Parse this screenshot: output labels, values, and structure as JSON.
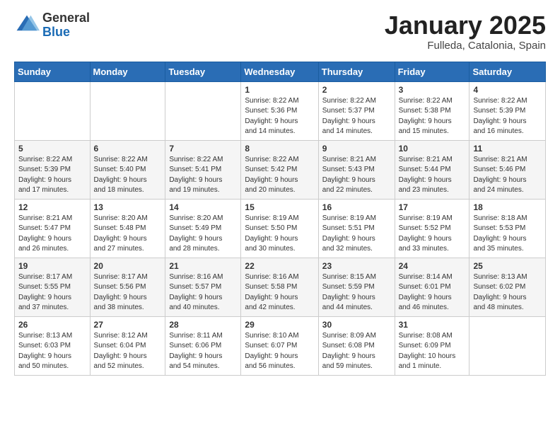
{
  "header": {
    "logo_general": "General",
    "logo_blue": "Blue",
    "month_title": "January 2025",
    "location": "Fulleda, Catalonia, Spain"
  },
  "days_of_week": [
    "Sunday",
    "Monday",
    "Tuesday",
    "Wednesday",
    "Thursday",
    "Friday",
    "Saturday"
  ],
  "weeks": [
    [
      {
        "day": "",
        "info": ""
      },
      {
        "day": "",
        "info": ""
      },
      {
        "day": "",
        "info": ""
      },
      {
        "day": "1",
        "info": "Sunrise: 8:22 AM\nSunset: 5:36 PM\nDaylight: 9 hours\nand 14 minutes."
      },
      {
        "day": "2",
        "info": "Sunrise: 8:22 AM\nSunset: 5:37 PM\nDaylight: 9 hours\nand 14 minutes."
      },
      {
        "day": "3",
        "info": "Sunrise: 8:22 AM\nSunset: 5:38 PM\nDaylight: 9 hours\nand 15 minutes."
      },
      {
        "day": "4",
        "info": "Sunrise: 8:22 AM\nSunset: 5:39 PM\nDaylight: 9 hours\nand 16 minutes."
      }
    ],
    [
      {
        "day": "5",
        "info": "Sunrise: 8:22 AM\nSunset: 5:39 PM\nDaylight: 9 hours\nand 17 minutes."
      },
      {
        "day": "6",
        "info": "Sunrise: 8:22 AM\nSunset: 5:40 PM\nDaylight: 9 hours\nand 18 minutes."
      },
      {
        "day": "7",
        "info": "Sunrise: 8:22 AM\nSunset: 5:41 PM\nDaylight: 9 hours\nand 19 minutes."
      },
      {
        "day": "8",
        "info": "Sunrise: 8:22 AM\nSunset: 5:42 PM\nDaylight: 9 hours\nand 20 minutes."
      },
      {
        "day": "9",
        "info": "Sunrise: 8:21 AM\nSunset: 5:43 PM\nDaylight: 9 hours\nand 22 minutes."
      },
      {
        "day": "10",
        "info": "Sunrise: 8:21 AM\nSunset: 5:44 PM\nDaylight: 9 hours\nand 23 minutes."
      },
      {
        "day": "11",
        "info": "Sunrise: 8:21 AM\nSunset: 5:46 PM\nDaylight: 9 hours\nand 24 minutes."
      }
    ],
    [
      {
        "day": "12",
        "info": "Sunrise: 8:21 AM\nSunset: 5:47 PM\nDaylight: 9 hours\nand 26 minutes."
      },
      {
        "day": "13",
        "info": "Sunrise: 8:20 AM\nSunset: 5:48 PM\nDaylight: 9 hours\nand 27 minutes."
      },
      {
        "day": "14",
        "info": "Sunrise: 8:20 AM\nSunset: 5:49 PM\nDaylight: 9 hours\nand 28 minutes."
      },
      {
        "day": "15",
        "info": "Sunrise: 8:19 AM\nSunset: 5:50 PM\nDaylight: 9 hours\nand 30 minutes."
      },
      {
        "day": "16",
        "info": "Sunrise: 8:19 AM\nSunset: 5:51 PM\nDaylight: 9 hours\nand 32 minutes."
      },
      {
        "day": "17",
        "info": "Sunrise: 8:19 AM\nSunset: 5:52 PM\nDaylight: 9 hours\nand 33 minutes."
      },
      {
        "day": "18",
        "info": "Sunrise: 8:18 AM\nSunset: 5:53 PM\nDaylight: 9 hours\nand 35 minutes."
      }
    ],
    [
      {
        "day": "19",
        "info": "Sunrise: 8:17 AM\nSunset: 5:55 PM\nDaylight: 9 hours\nand 37 minutes."
      },
      {
        "day": "20",
        "info": "Sunrise: 8:17 AM\nSunset: 5:56 PM\nDaylight: 9 hours\nand 38 minutes."
      },
      {
        "day": "21",
        "info": "Sunrise: 8:16 AM\nSunset: 5:57 PM\nDaylight: 9 hours\nand 40 minutes."
      },
      {
        "day": "22",
        "info": "Sunrise: 8:16 AM\nSunset: 5:58 PM\nDaylight: 9 hours\nand 42 minutes."
      },
      {
        "day": "23",
        "info": "Sunrise: 8:15 AM\nSunset: 5:59 PM\nDaylight: 9 hours\nand 44 minutes."
      },
      {
        "day": "24",
        "info": "Sunrise: 8:14 AM\nSunset: 6:01 PM\nDaylight: 9 hours\nand 46 minutes."
      },
      {
        "day": "25",
        "info": "Sunrise: 8:13 AM\nSunset: 6:02 PM\nDaylight: 9 hours\nand 48 minutes."
      }
    ],
    [
      {
        "day": "26",
        "info": "Sunrise: 8:13 AM\nSunset: 6:03 PM\nDaylight: 9 hours\nand 50 minutes."
      },
      {
        "day": "27",
        "info": "Sunrise: 8:12 AM\nSunset: 6:04 PM\nDaylight: 9 hours\nand 52 minutes."
      },
      {
        "day": "28",
        "info": "Sunrise: 8:11 AM\nSunset: 6:06 PM\nDaylight: 9 hours\nand 54 minutes."
      },
      {
        "day": "29",
        "info": "Sunrise: 8:10 AM\nSunset: 6:07 PM\nDaylight: 9 hours\nand 56 minutes."
      },
      {
        "day": "30",
        "info": "Sunrise: 8:09 AM\nSunset: 6:08 PM\nDaylight: 9 hours\nand 59 minutes."
      },
      {
        "day": "31",
        "info": "Sunrise: 8:08 AM\nSunset: 6:09 PM\nDaylight: 10 hours\nand 1 minute."
      },
      {
        "day": "",
        "info": ""
      }
    ]
  ]
}
